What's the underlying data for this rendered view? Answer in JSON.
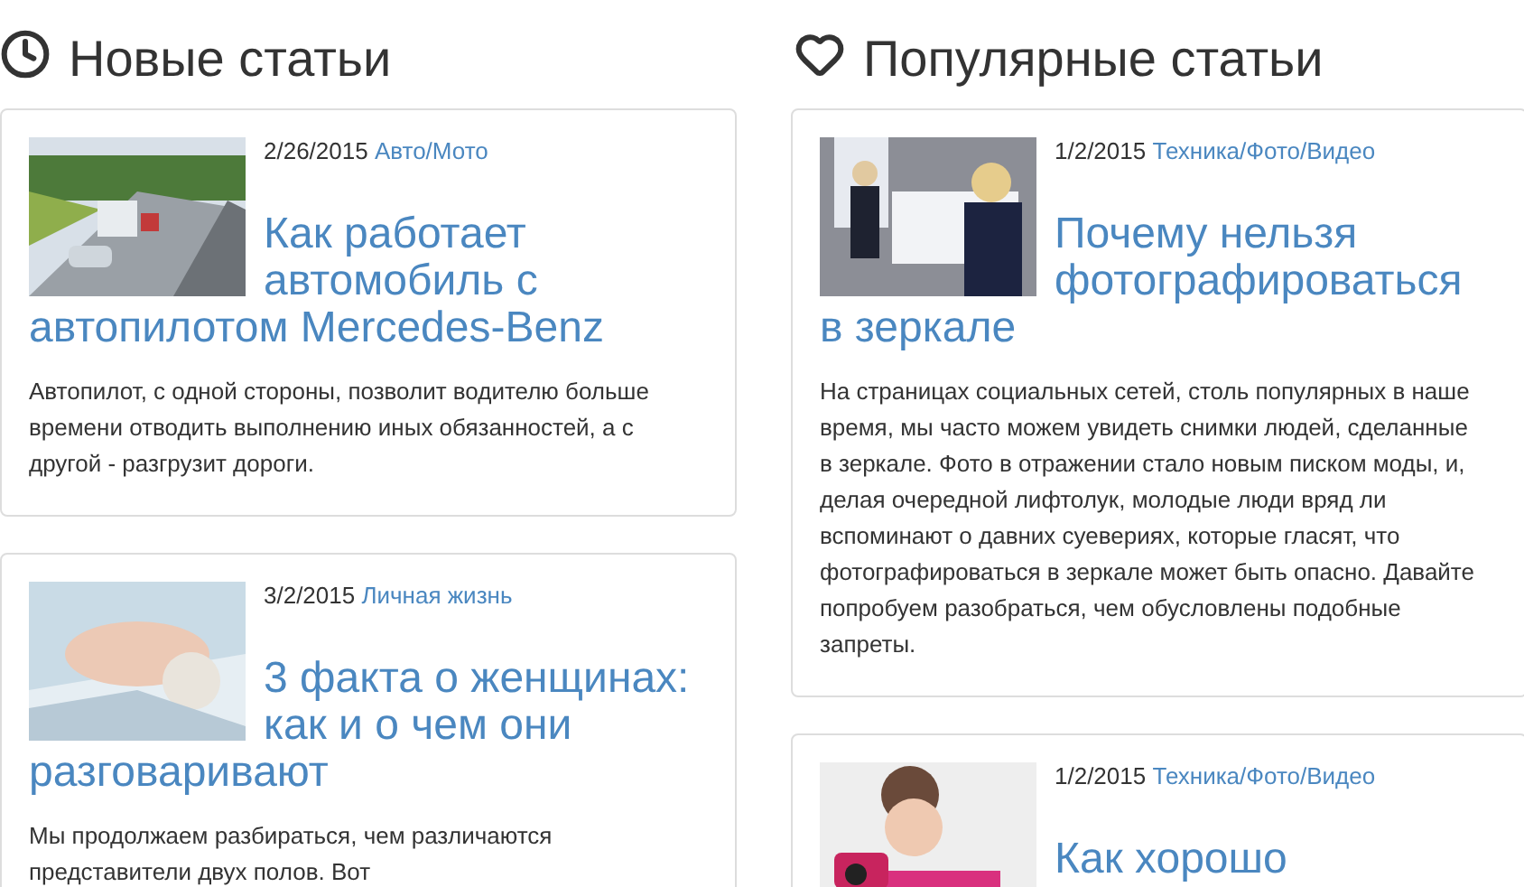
{
  "columns": [
    {
      "heading": "Новые статьи",
      "articles": [
        {
          "kind": "picture",
          "date": "2/26/2015",
          "category": "Авто/Мото",
          "title": "Как работает автомобиль с автопилотом Mercedes-Benz",
          "text": "Автопилот, с одной стороны, позволит водителю больше времени отводить выполнению иных обязанностей, а с другой - разгрузит дороги."
        },
        {
          "kind": "picture",
          "date": "3/2/2015",
          "category": "Личная жизнь",
          "title": "3 факта о женщинах: как и о чем они разговаривают",
          "text": "Мы продолжаем разбираться, чем различаются представители двух полов. Вот"
        }
      ]
    },
    {
      "heading": "Популярные статьи",
      "articles": [
        {
          "kind": "picture",
          "date": "1/2/2015",
          "category": "Техника/Фото/Видео",
          "title": "Почему нельзя фотографироваться в зеркале",
          "text": "На страницах социальных сетей, столь популярных в наше время, мы часто можем увидеть снимки людей, сделанные в зеркале. Фото в отражении стало новым писком моды, и, делая очередной лифтолук, молодые люди вряд ли вспоминают о давних суевериях, которые гласят, что фотографироваться в зеркале может быть опасно. Давайте попробуем разобраться, чем обусловлены подобные запреты."
        },
        {
          "kind": "picture",
          "date": "1/2/2015",
          "category": "Техника/Фото/Видео",
          "title": "Как хорошо"
        }
      ]
    }
  ]
}
